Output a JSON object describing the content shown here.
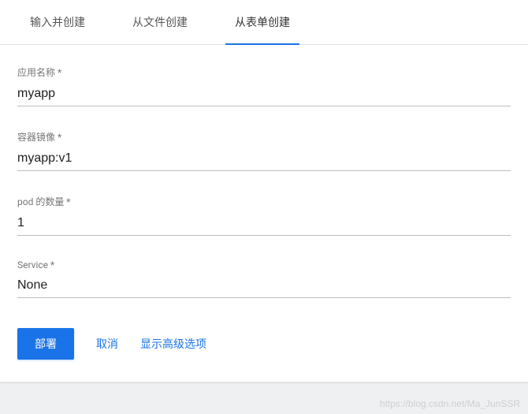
{
  "tabs": [
    {
      "label": "输入并创建",
      "active": false
    },
    {
      "label": "从文件创建",
      "active": false
    },
    {
      "label": "从表单创建",
      "active": true
    }
  ],
  "form": {
    "appName": {
      "label": "应用名称 *",
      "value": "myapp"
    },
    "containerImage": {
      "label": "容器镜像 *",
      "value": "myapp:v1"
    },
    "podCount": {
      "label": "pod 的数量 *",
      "value": "1"
    },
    "service": {
      "label": "Service *",
      "value": "None"
    }
  },
  "actions": {
    "deploy": "部署",
    "cancel": "取消",
    "showAdvanced": "显示高级选项"
  },
  "watermark": "https://blog.csdn.net/Ma_JunSSR"
}
